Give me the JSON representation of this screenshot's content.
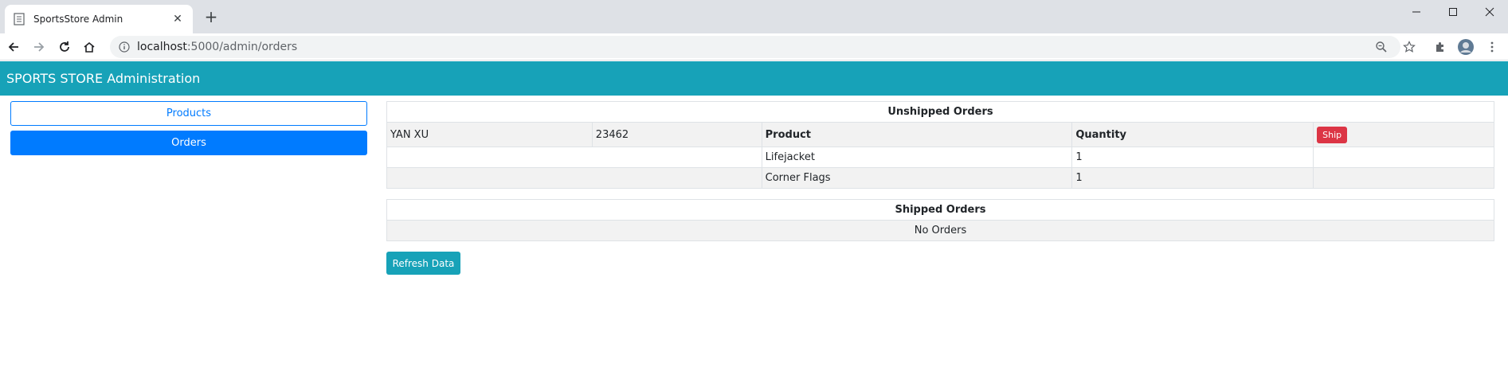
{
  "browser": {
    "tab_title": "SportsStore Admin",
    "tab_close": "✕",
    "new_tab": "+",
    "url_host": "localhost",
    "url_path": ":5000/admin/orders"
  },
  "app": {
    "header_title": "SPORTS STORE Administration"
  },
  "sidebar": {
    "items": [
      {
        "label": "Products"
      },
      {
        "label": "Orders"
      }
    ]
  },
  "unshipped": {
    "title": "Unshipped Orders",
    "order": {
      "name": "YAN XU",
      "zip": "23462",
      "product_header": "Product",
      "quantity_header": "Quantity",
      "ship_label": "Ship",
      "lines": [
        {
          "product": "Lifejacket",
          "quantity": "1"
        },
        {
          "product": "Corner Flags",
          "quantity": "1"
        }
      ]
    }
  },
  "shipped": {
    "title": "Shipped Orders",
    "empty_text": "No Orders"
  },
  "actions": {
    "refresh_label": "Refresh Data"
  },
  "colors": {
    "accent": "#17a2b8",
    "primary": "#007bff",
    "danger": "#dc3545"
  }
}
